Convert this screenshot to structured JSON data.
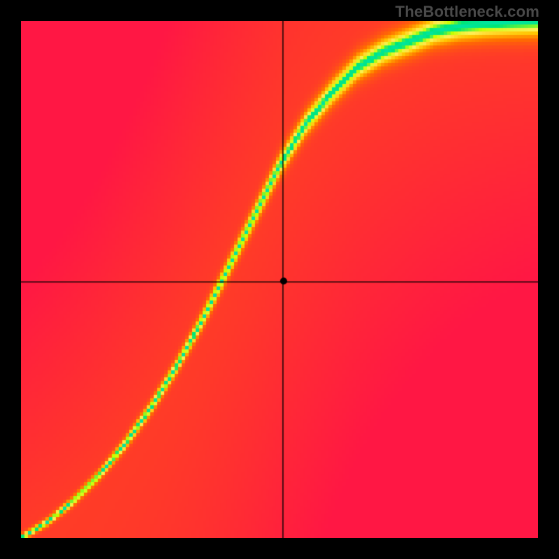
{
  "watermark": "TheBottleneck.com",
  "chart_data": {
    "type": "heatmap",
    "title": "",
    "xlabel": "",
    "ylabel": "",
    "xlim": [
      0,
      100
    ],
    "ylim": [
      0,
      100
    ],
    "grid": false,
    "crosshair": {
      "x_frac": 0.506,
      "y_frac": 0.496
    },
    "marker": {
      "x_frac": 0.508,
      "y_frac": 0.497,
      "radius": 5
    },
    "optimal_curve": {
      "description": "y = f(x) on [0,1] -> [0,1]; the green band follows an S-like curve biased toward upper-right",
      "x": [
        0.0,
        0.05,
        0.1,
        0.15,
        0.2,
        0.25,
        0.3,
        0.35,
        0.4,
        0.45,
        0.5,
        0.55,
        0.6,
        0.65,
        0.7,
        0.75,
        0.8,
        0.85,
        0.9,
        0.95,
        1.0
      ],
      "y": [
        0.0,
        0.03,
        0.07,
        0.12,
        0.18,
        0.25,
        0.33,
        0.42,
        0.52,
        0.62,
        0.72,
        0.8,
        0.86,
        0.91,
        0.94,
        0.96,
        0.98,
        0.99,
        0.995,
        0.998,
        1.0
      ]
    },
    "heatmap_params": {
      "band_sharpness": 6.5,
      "corner_falloff": 0.55,
      "resolution": 148,
      "palette": [
        {
          "t": 0.0,
          "color": "#ff1744"
        },
        {
          "t": 0.35,
          "color": "#ff6d00"
        },
        {
          "t": 0.55,
          "color": "#ffc400"
        },
        {
          "t": 0.7,
          "color": "#ffee58"
        },
        {
          "t": 0.82,
          "color": "#c6ff00"
        },
        {
          "t": 0.92,
          "color": "#00e676"
        },
        {
          "t": 1.0,
          "color": "#00e5a0"
        }
      ]
    }
  }
}
